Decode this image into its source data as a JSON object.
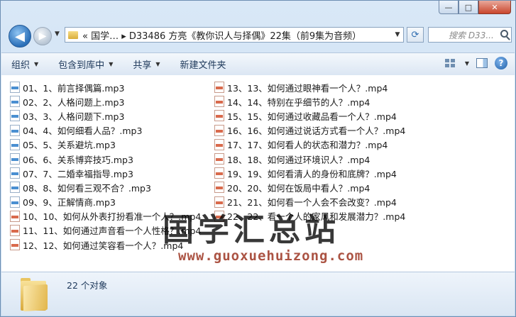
{
  "window": {
    "caption_buttons": {
      "minimize": "—",
      "maximize": "□",
      "close": "✕"
    }
  },
  "nav": {
    "back_icon": "back-arrow-icon",
    "forward_icon": "forward-arrow-icon",
    "address_text": "« 国学… ▸ D33486 方亮《教你识人与择偶》22集（前9集为音频）",
    "search_placeholder": "搜索 D33..."
  },
  "toolbar": {
    "organize": "组织",
    "include_in_library": "包含到库中",
    "share": "共享",
    "new_folder": "新建文件夹"
  },
  "files_col1": [
    {
      "name": "01、1、前言择偶篇.mp3",
      "type": "mp3"
    },
    {
      "name": "02、2、人格问题上.mp3",
      "type": "mp3"
    },
    {
      "name": "03、3、人格问题下.mp3",
      "type": "mp3"
    },
    {
      "name": "04、4、如何细看人品？.mp3",
      "type": "mp3"
    },
    {
      "name": "05、5、关系避坑.mp3",
      "type": "mp3"
    },
    {
      "name": "06、6、关系博弈技巧.mp3",
      "type": "mp3"
    },
    {
      "name": "07、7、二婚幸福指导.mp3",
      "type": "mp3"
    },
    {
      "name": "08、8、如何看三观不合？.mp3",
      "type": "mp3"
    },
    {
      "name": "09、9、正解情商.mp3",
      "type": "mp3"
    },
    {
      "name": "10、10、如何从外表打扮看准一个人？.mp4",
      "type": "mp4"
    },
    {
      "name": "11、11、如何通过声音看一个人性格？.mp4",
      "type": "mp4"
    },
    {
      "name": "12、12、如何通过笑容看一个人？.mp4",
      "type": "mp4"
    }
  ],
  "files_col2": [
    {
      "name": "13、13、如何通过眼神看一个人？.mp4",
      "type": "mp4"
    },
    {
      "name": "14、14、特别在乎细节的人？.mp4",
      "type": "mp4"
    },
    {
      "name": "15、15、如何通过收藏品看一个人？.mp4",
      "type": "mp4"
    },
    {
      "name": "16、16、如何通过说话方式看一个人？.mp4",
      "type": "mp4"
    },
    {
      "name": "17、17、如何看人的状态和潜力？.mp4",
      "type": "mp4"
    },
    {
      "name": "18、18、如何通过环境识人？.mp4",
      "type": "mp4"
    },
    {
      "name": "19、19、如何看清人的身份和底牌？.mp4",
      "type": "mp4"
    },
    {
      "name": "20、20、如何在饭局中看人？.mp4",
      "type": "mp4"
    },
    {
      "name": "21、21、如何看一个人会不会改变？.mp4",
      "type": "mp4"
    },
    {
      "name": "22、22、看一个人的家风和发展潜力？.mp4",
      "type": "mp4"
    }
  ],
  "watermark": {
    "title": "国学汇总站",
    "url": "www.guoxuehuizong.com"
  },
  "details": {
    "count": "22 个对象"
  }
}
